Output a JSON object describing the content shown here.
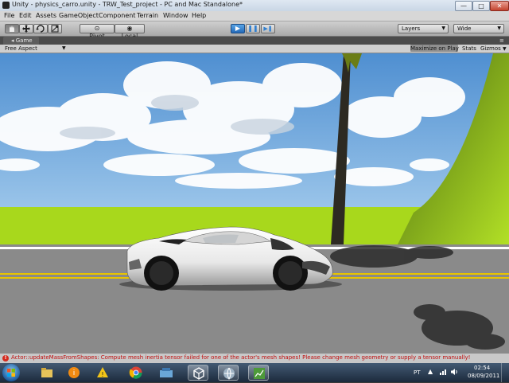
{
  "window": {
    "title": "Unity - physics_carro.unity - TRW_Test_project - PC and Mac Standalone*",
    "minimize_glyph": "—",
    "maximize_glyph": "□",
    "close_glyph": "✕"
  },
  "menu": {
    "items": [
      "File",
      "Edit",
      "Assets",
      "GameObject",
      "Component",
      "Terrain",
      "Window",
      "Help"
    ]
  },
  "toolbar": {
    "pivot_label": "Pivot",
    "local_label": "Local",
    "layers_label": "Layers",
    "layout_label": "Wide",
    "play_glyph": "▶",
    "pause_glyph": "❚❚",
    "step_glyph": "▶❚"
  },
  "game_panel": {
    "tab_label": "Game",
    "aspect_label": "Free Aspect",
    "maximize_label": "Maximize on Play",
    "stats_label": "Stats",
    "gizmos_label": "Gizmos"
  },
  "console": {
    "error_text": "Actor::updateMassFromShapes: Compute mesh inertia tensor failed for one of the actor's mesh shapes! Please change mesh geometry or supply a tensor manually!"
  },
  "taskbar": {
    "language": "PT",
    "time": "02:54",
    "date": "08/09/2011"
  },
  "colors": {
    "play_blue": "#2f7fd0",
    "error_red": "#c01010",
    "sky": "#6ea7dd",
    "grass": "#a8d81c",
    "road": "#8a8a8a",
    "road_line": "#e8c400"
  }
}
